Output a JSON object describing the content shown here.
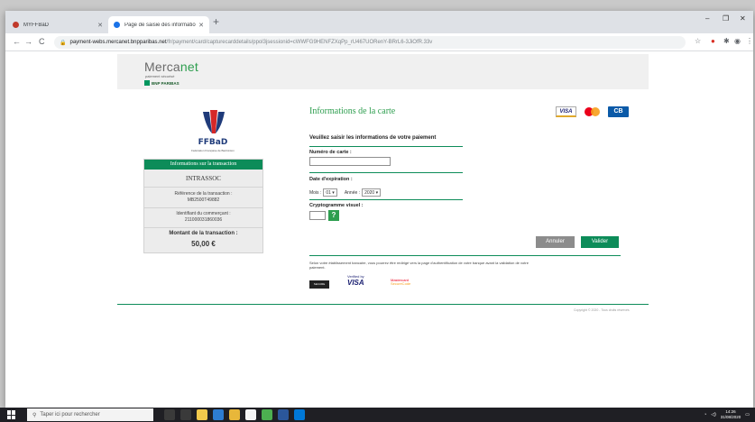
{
  "browser": {
    "tabs": [
      {
        "title": "MYFFBaD",
        "active": false
      },
      {
        "title": "Page de saisie des informations...",
        "active": true
      }
    ],
    "new_tab": "+",
    "window_controls": {
      "minimize": "–",
      "restore": "❐",
      "close": "✕"
    },
    "nav": {
      "back": "←",
      "forward": "→",
      "reload": "C"
    },
    "url_host": "payment-webs.mercanet.bnpparibas.net",
    "url_path": "/fr/payment/card/capturecarddetails/ppol3jsessionid=cWWFG9HENFZXqPp_rU467UORenY-BRrL6-3JiOfR.33v"
  },
  "merchant_header": {
    "logo_word_main": "Merca",
    "logo_word_accent": "net",
    "logo_sub": "paiement sécurisé",
    "bank": "BNP PARIBAS"
  },
  "org": {
    "name": "FFBaD",
    "subtitle": "Fédération Française de Badminton"
  },
  "transaction": {
    "header": "Informations sur la transaction",
    "merchant": "INTRASSOC",
    "ref_label": "Référence de la transaction :",
    "ref_value": "MB2500T49882",
    "merchant_id_label": "Identifiant du commerçant :",
    "merchant_id_value": "211000031860036",
    "amount_label": "Montant de la transaction :",
    "amount_value": "50,00 €"
  },
  "form": {
    "title": "Informations de la carte",
    "card_logos": [
      "VISA",
      "Mastercard",
      "CB"
    ],
    "prompt": "Veuillez saisir les informations de votre paiement",
    "card_number_label": "Numéro de carte :",
    "card_number_value": "",
    "expiry_label": "Date d'expiration :",
    "month_label": "Mois :",
    "month_value": "01",
    "year_label": "Année :",
    "year_value": "2020",
    "cvv_label": "Cryptogramme visuel :",
    "cvv_value": "",
    "help_label": "?",
    "cancel_label": "Annuler",
    "submit_label": "Valider",
    "notice": "Selon votre établissement bancaire, vous pourrez être redirigé vers la page d'authentification de votre banque avant la validation de votre paiement.",
    "secure_badge": "SECURE",
    "verified_line1": "Verified by",
    "verified_line2": "VISA",
    "mc_line1": "Mastercard",
    "mc_line2": "SecureCode",
    "copyright": "Copyright © 2020 - Tous droits réservés"
  },
  "taskbar": {
    "search_placeholder": "Taper ici pour rechercher",
    "time": "14:26",
    "date": "31/08/2020"
  },
  "colors": {
    "brand_green": "#0d8c59",
    "title_green": "#2e9e4f",
    "cancel_gray": "#8c8c8c"
  }
}
